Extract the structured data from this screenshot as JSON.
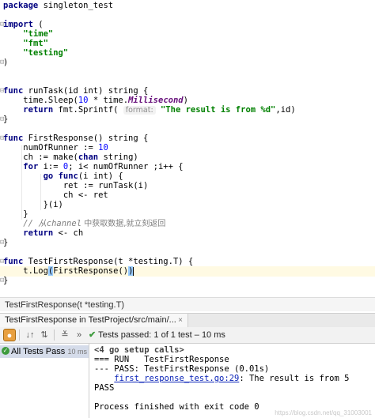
{
  "editor": {
    "lines": {
      "l1": {
        "kw": "package",
        "rest": " singleton_test"
      },
      "l3": {
        "kw": "import",
        "rest": " ("
      },
      "l4": "\"time\"",
      "l5": "\"fmt\"",
      "l6": "\"testing\"",
      "l7": ")",
      "l10a": "func",
      "l10b": " runTask(id int) string {",
      "l11a": "time.Sleep(",
      "l11b": "10",
      "l11c": " * time.",
      "l11d": "Millisecond",
      "l11e": ")",
      "l12a": "return",
      "l12b": " fmt.Sprintf( ",
      "l12hint": "format:",
      "l12c": " \"The result is from %d\"",
      "l12d": ",id)",
      "l13": "}",
      "l15a": "func",
      "l15b": " FirstResponse() string {",
      "l16a": "numOfRunner := ",
      "l16b": "10",
      "l17a": "ch := make(",
      "l17b": "chan",
      "l17c": " string)",
      "l18a": "for",
      "l18b": " i:= ",
      "l18c": "0",
      "l18d": "; i< numOfRunner ;i++ {",
      "l19a": "go",
      "l19b": " ",
      "l19c": "func",
      "l19d": "(i int) {",
      "l20": "ret := runTask(i)",
      "l21": "ch <- ret",
      "l22": "}(i)",
      "l23": "}",
      "l24a": "// 从",
      "l24b": "channel",
      "l24c": " 中获取数据,就立刻返回",
      "l25a": "return",
      "l25b": " <- ch",
      "l26": "}",
      "l28a": "func",
      "l28b": " TestFirstResponse(t *testing.T) {",
      "l29a": "t.Log",
      "l29b": "(",
      "l29c": "FirstResponse()",
      "l29d": ")",
      "l30": "}"
    }
  },
  "breadcrumb": "TestFirstResponse(t *testing.T)",
  "run_tab": {
    "title": "TestFirstResponse in TestProject/src/main/...",
    "close": "×"
  },
  "toolbar": {
    "status_prefix": "Tests passed: ",
    "status_value": "1 of 1 test – 10 ms"
  },
  "test_tree": {
    "label": "All Tests Pass",
    "duration": "10 ms"
  },
  "console": {
    "lines": [
      "<4 go setup calls>",
      "=== RUN   TestFirstResponse",
      "--- PASS: TestFirstResponse (0.01s)",
      "PASS",
      "",
      "Process finished with exit code 0"
    ],
    "link_text": "first_response_test.go:29",
    "link_rest": ": The result is from 5"
  },
  "watermark": "https://blog.csdn.net/qq_31003001",
  "colors": {
    "pass": "#3d9b3d",
    "keyword": "#000080",
    "string": "#008000"
  }
}
